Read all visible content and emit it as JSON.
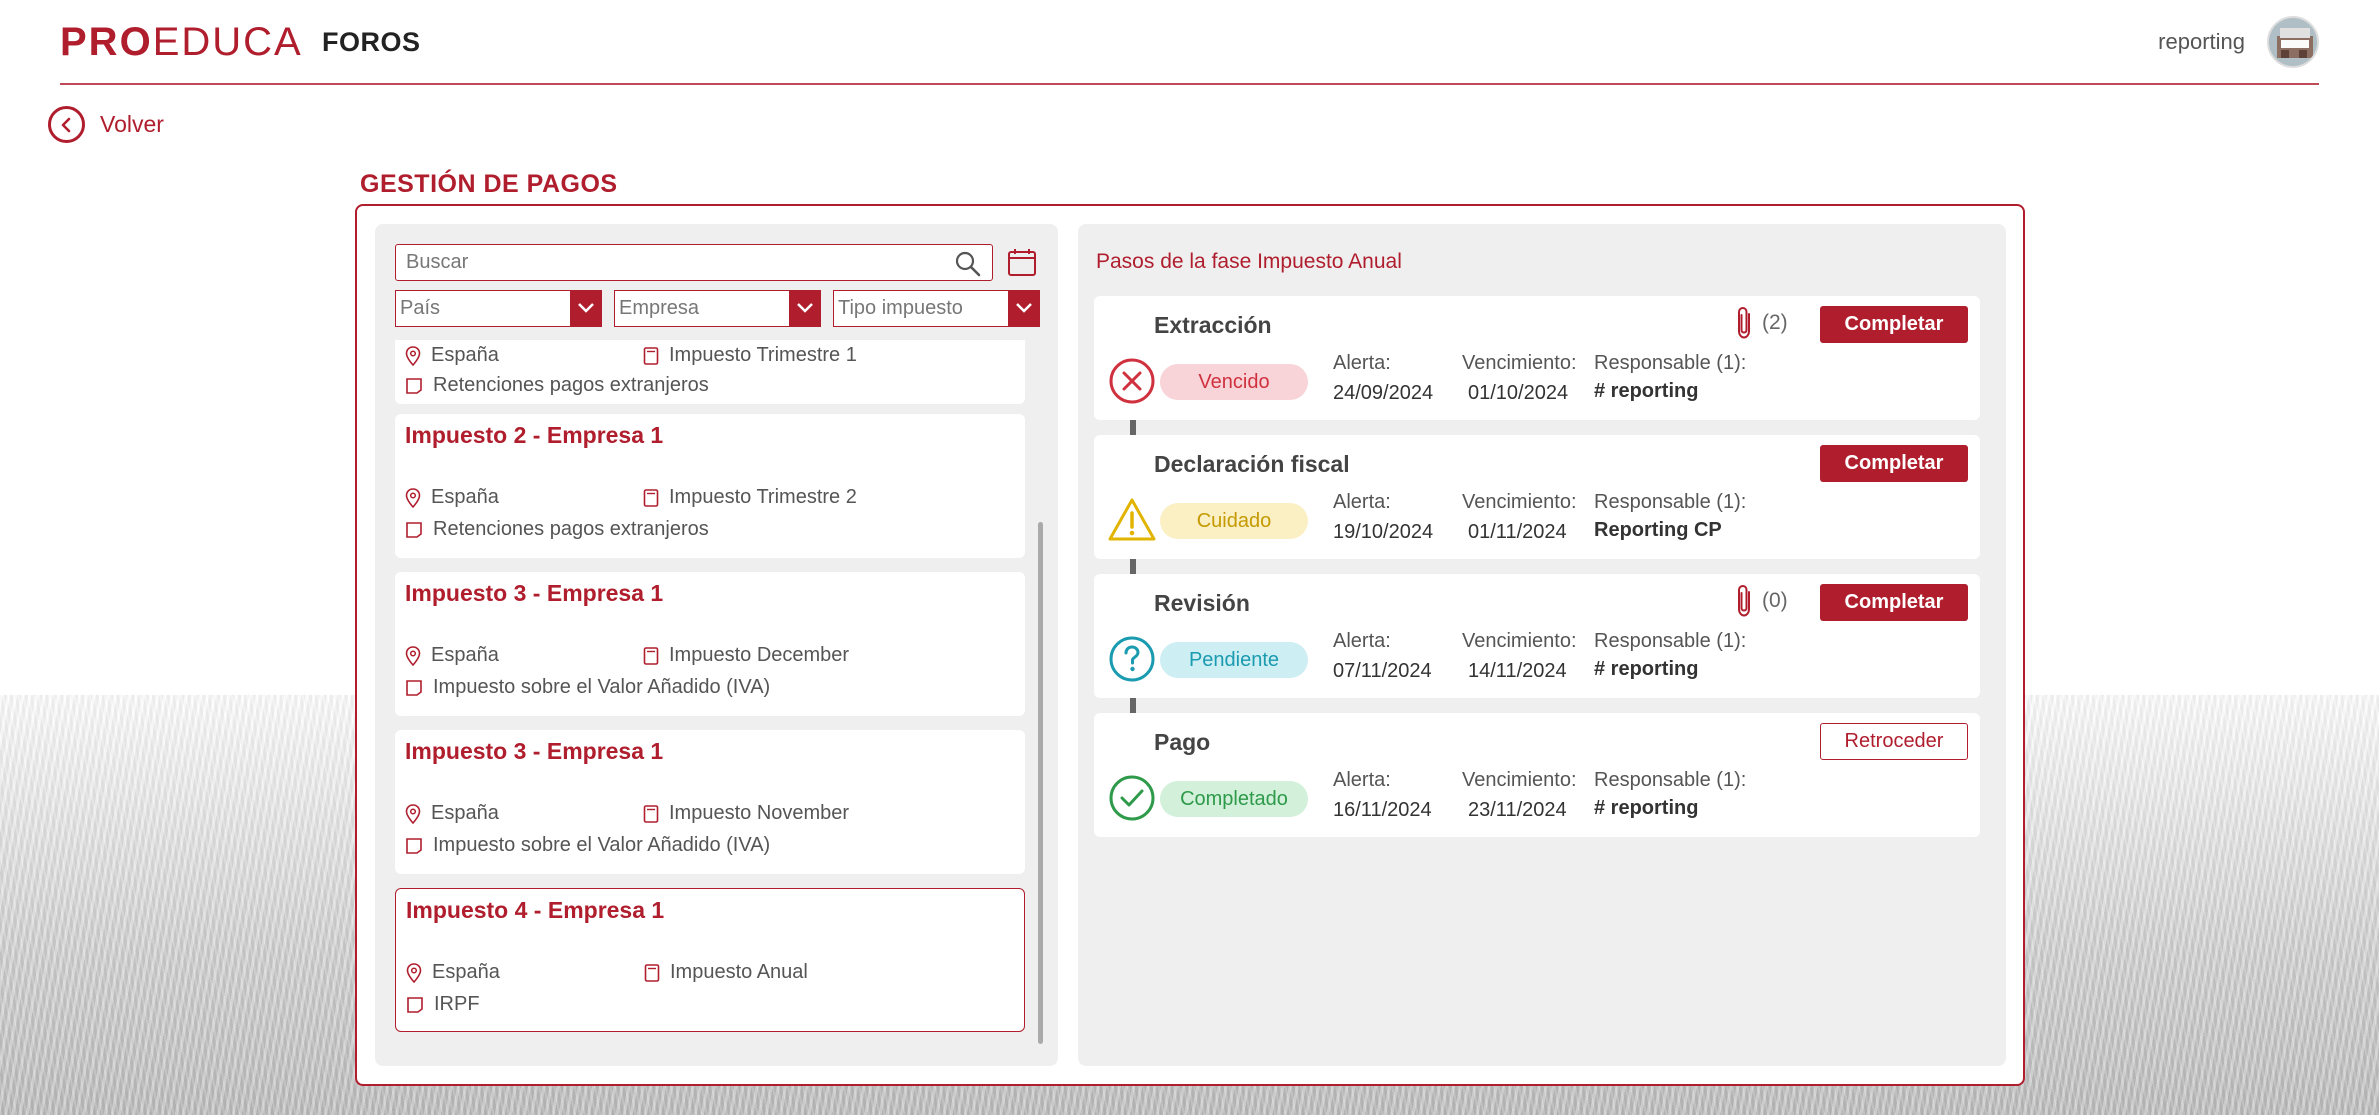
{
  "header": {
    "logo_pro": "PRO",
    "logo_educa": "EDUCA",
    "app_name": "FOROS",
    "user_name": "reporting"
  },
  "back_label": "Volver",
  "page_title": "GESTIÓN DE PAGOS",
  "search": {
    "placeholder": "Buscar"
  },
  "filters": [
    {
      "label": "País"
    },
    {
      "label": "Empresa"
    },
    {
      "label": "Tipo impuesto"
    }
  ],
  "tax_list": [
    {
      "title": "",
      "country": "España",
      "period": "Impuesto Trimestre 1",
      "type": "Retenciones pagos extranjeros"
    },
    {
      "title": "Impuesto 2 - Empresa 1",
      "country": "España",
      "period": "Impuesto Trimestre 2",
      "type": "Retenciones pagos extranjeros"
    },
    {
      "title": "Impuesto 3 - Empresa 1",
      "country": "España",
      "period": "Impuesto December",
      "type": "Impuesto sobre el Valor Añadido (IVA)"
    },
    {
      "title": "Impuesto 3 - Empresa 1",
      "country": "España",
      "period": "Impuesto November",
      "type": "Impuesto sobre el Valor Añadido (IVA)"
    },
    {
      "title": "Impuesto 4 - Empresa 1",
      "country": "España",
      "period": "Impuesto Anual",
      "type": "IRPF"
    }
  ],
  "phase": {
    "title": "Pasos de la fase Impuesto Anual",
    "labels": {
      "alert": "Alerta:",
      "due": "Vencimiento:",
      "responsible": "Responsable (1):"
    },
    "steps": [
      {
        "name": "Extracción",
        "status": "Vencido",
        "status_icon": "x-circle-icon",
        "alert": "24/09/2024",
        "due": "01/10/2024",
        "responsible": "# reporting",
        "attachments": "(2)",
        "action": "Completar"
      },
      {
        "name": "Declaración fiscal",
        "status": "Cuidado",
        "status_icon": "warning-icon",
        "alert": "19/10/2024",
        "due": "01/11/2024",
        "responsible": "Reporting CP",
        "attachments": "",
        "action": "Completar"
      },
      {
        "name": "Revisión",
        "status": "Pendiente",
        "status_icon": "question-circle-icon",
        "alert": "07/11/2024",
        "due": "14/11/2024",
        "responsible": "# reporting",
        "attachments": "(0)",
        "action": "Completar"
      },
      {
        "name": "Pago",
        "status": "Completado",
        "status_icon": "check-circle-icon",
        "alert": "16/11/2024",
        "due": "23/11/2024",
        "responsible": "# reporting",
        "attachments": "",
        "action": "Retroceder"
      }
    ]
  },
  "colors": {
    "brand": "#b01e2e",
    "vencido_bg": "#f8d3d7",
    "vencido_fg": "#d0313f",
    "cuidado_bg": "#fbefc4",
    "cuidado_fg": "#c49a00",
    "pendiente_bg": "#cdeef3",
    "pendiente_fg": "#1a9bb0",
    "completado_bg": "#d2f0da",
    "completado_fg": "#2e9a4a"
  }
}
